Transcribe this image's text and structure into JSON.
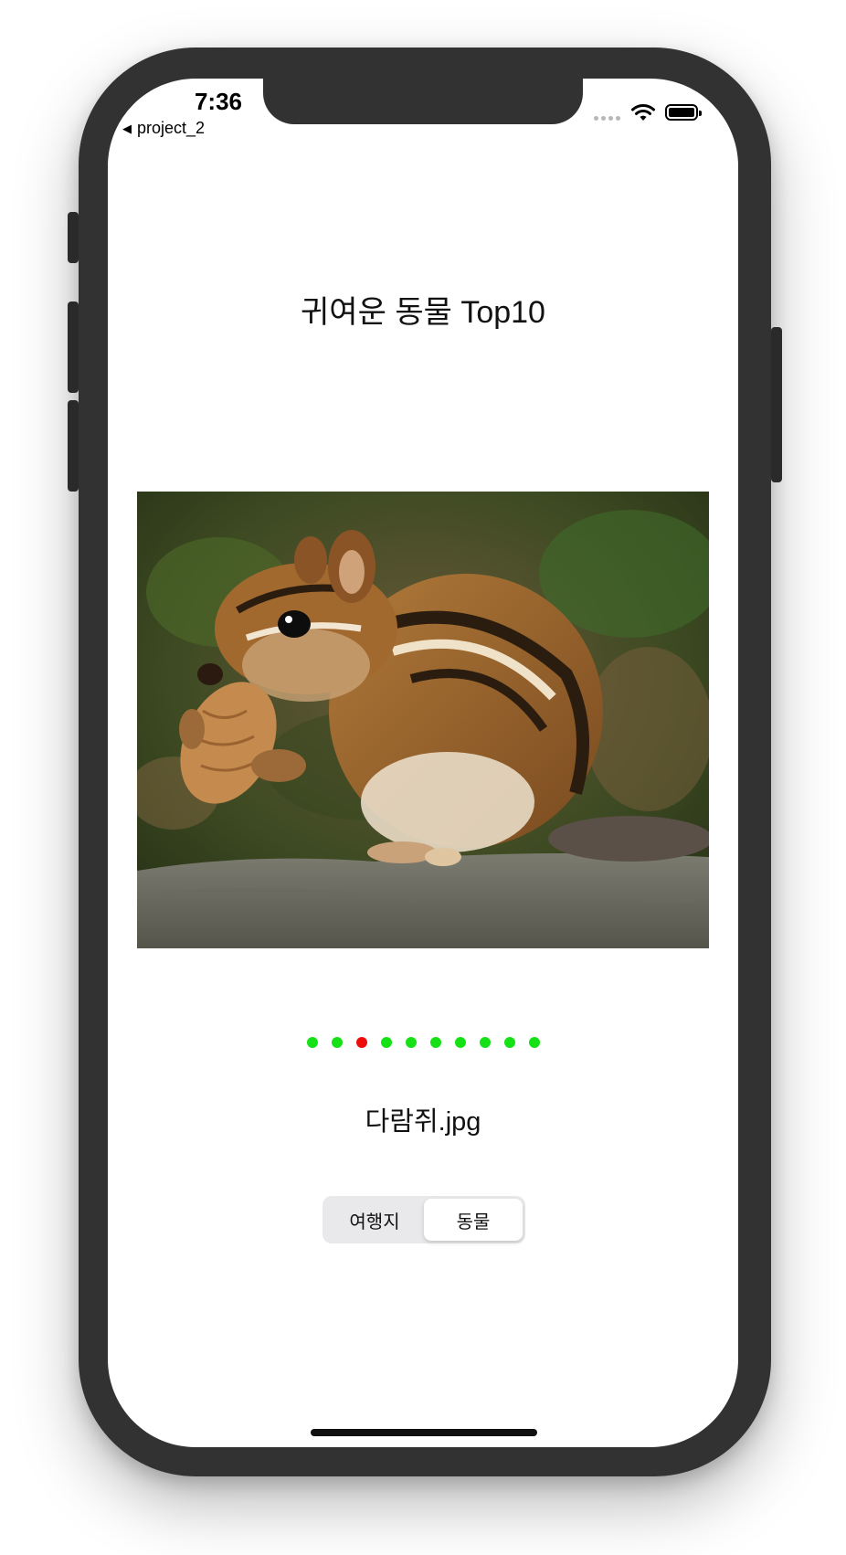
{
  "status_bar": {
    "time": "7:36",
    "back_label": "project_2",
    "back_icon": "back-triangle-icon",
    "wifi_icon": "wifi-icon",
    "battery_icon": "battery-icon"
  },
  "title": "귀여운 동물 Top10",
  "image": {
    "subject": "chipmunk eating a peanut on a rock",
    "icon": "photo-image"
  },
  "page_control": {
    "total": 10,
    "current_index": 2,
    "active_color": "#ee0d0d",
    "inactive_color": "#16e016"
  },
  "filename": "다람쥐.jpg",
  "segmented": {
    "options": [
      "여행지",
      "동물"
    ],
    "selected_index": 1
  },
  "colors": {
    "bezel": "#323232",
    "segment_bg": "#e9e9eb"
  }
}
